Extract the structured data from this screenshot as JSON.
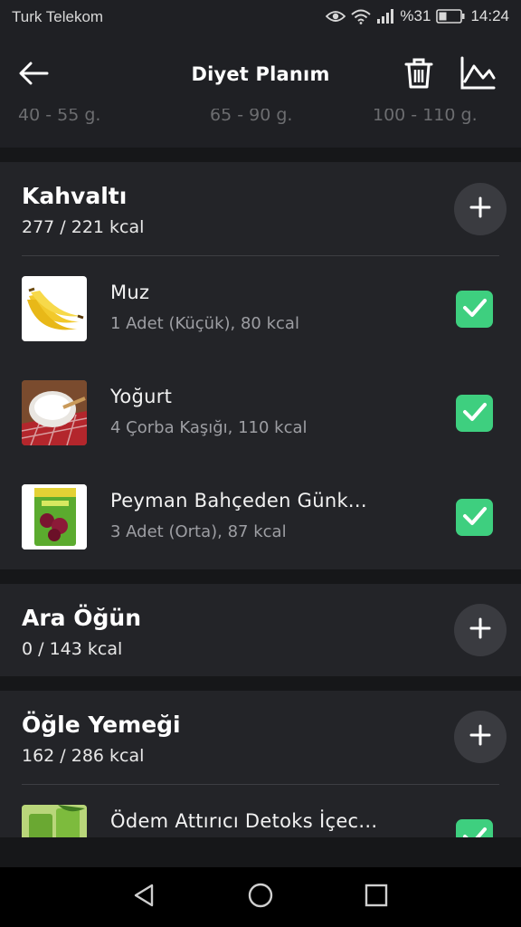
{
  "status": {
    "carrier": "Turk Telekom",
    "battery": "%31",
    "time": "14:24"
  },
  "header": {
    "title": "Diyet Planım",
    "back_icon": "arrow-left-icon",
    "trash_icon": "trash-icon",
    "chart_icon": "line-chart-icon"
  },
  "macros": {
    "values": [
      "40 - 55 g.",
      "65 - 90 g.",
      "100 - 110 g."
    ]
  },
  "meals": [
    {
      "title": "Kahvaltı",
      "kcal": "277 / 221 kcal",
      "items": [
        {
          "name": "Muz",
          "detail": "1 Adet (Küçük), 80 kcal",
          "thumb": "banana",
          "checked": true
        },
        {
          "name": "Yoğurt",
          "detail": "4 Çorba Kaşığı, 110 kcal",
          "thumb": "yogurt-bowl",
          "checked": true
        },
        {
          "name": "Peyman Bahçeden Günk...",
          "detail": "3 Adet (Orta), 87 kcal",
          "thumb": "dried-fruit-package",
          "checked": true
        }
      ]
    },
    {
      "title": "Ara Öğün",
      "kcal": "0 / 143 kcal",
      "items": []
    },
    {
      "title": "Öğle Yemeği",
      "kcal": "162 / 286 kcal",
      "items": [
        {
          "name": "Ödem Attırıcı Detoks İçec...",
          "detail": "",
          "thumb": "green-drink",
          "checked": true
        }
      ]
    }
  ],
  "colors": {
    "background": "#161719",
    "card": "#232428",
    "check": "#3ecf7f",
    "add_button": "#3a3b40"
  }
}
